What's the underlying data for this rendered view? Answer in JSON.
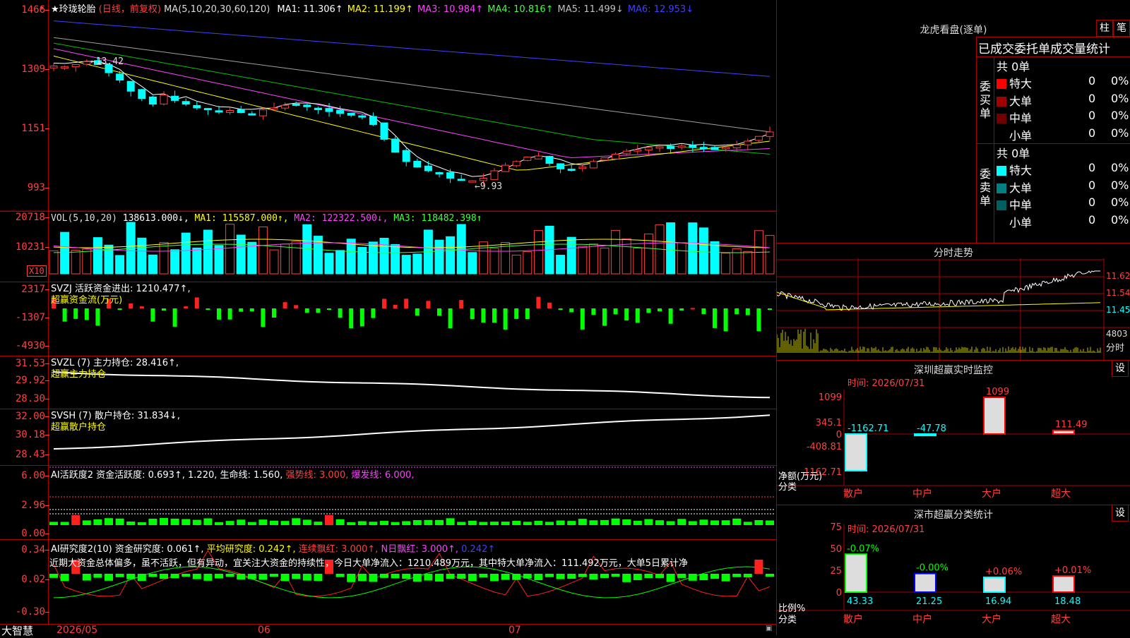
{
  "app": {
    "brand": "大智慧"
  },
  "stock": {
    "name": "★玲珑轮胎",
    "period": "(日线，前复权)",
    "ma_label": "MA(5,10,20,30,60,120)",
    "ma": [
      {
        "k": "MA1:",
        "v": "11.306↑",
        "c": "#ffffff"
      },
      {
        "k": "MA2:",
        "v": "11.199↑",
        "c": "#ffff00"
      },
      {
        "k": "MA3:",
        "v": "10.984↑",
        "c": "#ff40ff"
      },
      {
        "k": "MA4:",
        "v": "10.816↑",
        "c": "#40ff40"
      },
      {
        "k": "MA5:",
        "v": "11.499↓",
        "c": "#c0c0c0"
      },
      {
        "k": "MA6:",
        "v": "12.953↓",
        "c": "#4040ff"
      }
    ],
    "yaxis": [
      "1466",
      "1309",
      "1151",
      "993"
    ],
    "hi_label": "←13.42",
    "lo_label": "←9.93"
  },
  "vol": {
    "label": "VOL(5,10,20)",
    "val": "138613.000↓,",
    "ma1": "MA1: 115587.000↑,",
    "ma2": "MA2: 122322.500↓,",
    "ma3": "MA3: 118482.398↑",
    "yaxis": [
      "20718",
      "10231"
    ],
    "unit": "X10"
  },
  "svzj": {
    "label": "SVZJ  活跃资金进出: 1210.477↑,",
    "sub": "超赢资金流(万元)",
    "yaxis": [
      "2317",
      "-1307",
      "-4930"
    ]
  },
  "svzl": {
    "label": "SVZL (7) 主力持仓: 28.416↑,",
    "sub": "超赢主力持仓",
    "yaxis": [
      "31.53",
      "29.92",
      "28.30"
    ]
  },
  "svsh": {
    "label": "SVSH (7) 散户持仓: 31.834↓,",
    "sub": "超赢散户持仓",
    "yaxis": [
      "32.00",
      "30.18",
      "28.43"
    ]
  },
  "ai1": {
    "label": "AI活跃度2 资金活跃度: 0.693↑, 1.220, 生命线: 1.560,",
    "strong": "强势线: 3.000,",
    "burst": "爆发线: 6.000,",
    "yaxis": [
      "6.00",
      "2.96",
      "0.00"
    ]
  },
  "ai2": {
    "label": "AI研究度2(10) 资金研究度: 0.061↑,",
    "avg": "平均研究度: 0.242↑,",
    "red": "连续飘红: 3.000↑,",
    "nred": "N日飘红: 3.000↑,",
    "last": "0.242↑",
    "comment": "近期大资金总体偏多，虽不活跃，但有异动，宜关注大资金的持续性，今日大单净流入：1210.489万元，其中特大单净流入：111.492万元，大单5日累计净",
    "yaxis": [
      "0.34",
      "0.02",
      "-0.30"
    ]
  },
  "xaxis": [
    "2026/05",
    "06",
    "07"
  ],
  "lhb": {
    "title": "龙虎看盘(逐单)",
    "btn1": "柱",
    "btn2": "笔",
    "heading": "已成交委托单成交量统计",
    "buy_label": "委买单",
    "sell_label": "委卖单",
    "buy_total": "共 0单",
    "sell_total": "共 0单",
    "buy": [
      {
        "n": "特大",
        "c": "#ff0000",
        "v": "0",
        "p": "0%"
      },
      {
        "n": "大单",
        "c": "#a00000",
        "v": "0",
        "p": "0%"
      },
      {
        "n": "中单",
        "c": "#700000",
        "v": "0",
        "p": "0%"
      },
      {
        "n": "小单",
        "c": "#000000",
        "v": "0",
        "p": "0%"
      }
    ],
    "sell": [
      {
        "n": "特大",
        "c": "#00ffff",
        "v": "0",
        "p": "0%"
      },
      {
        "n": "大单",
        "c": "#008080",
        "v": "0",
        "p": "0%"
      },
      {
        "n": "中单",
        "c": "#006060",
        "v": "0",
        "p": "0%"
      },
      {
        "n": "小单",
        "c": "#000000",
        "v": "0",
        "p": "0%"
      }
    ]
  },
  "fenshi": {
    "title": "分时走势",
    "yaxis": [
      "11.62",
      "11.54",
      "11.45"
    ],
    "vol": "4803",
    "vol_label": "分时"
  },
  "monitor": {
    "title": "深圳超赢实时监控",
    "btn": "设",
    "time": "时间: 2026/07/31",
    "yaxis": [
      "1099",
      "345.1",
      "0",
      "-408.81",
      "-1162.71"
    ],
    "net_label": "净额(万元)",
    "cat_label": "分类",
    "bars": [
      {
        "n": "散户",
        "v": -1162.71,
        "t": "-1162.71",
        "c": "#00ffff"
      },
      {
        "n": "中户",
        "v": -47.78,
        "t": "-47.78",
        "c": "#00ffff"
      },
      {
        "n": "大户",
        "v": 1099,
        "t": "1099",
        "c": "#ff0000"
      },
      {
        "n": "超大",
        "v": 111.49,
        "t": "111.49",
        "c": "#ff0000"
      }
    ]
  },
  "stats": {
    "title": "深市超赢分类统计",
    "btn": "设",
    "time": "时间: 2026/07/31",
    "yaxis": [
      "75",
      "50",
      "25",
      "0"
    ],
    "ratio_label": "比例%",
    "cat_label": "分类",
    "bars": [
      {
        "n": "散户",
        "v": 43.33,
        "t": "43.33",
        "d": "-0.07%",
        "c": "#00ff00",
        "dc": "#00ff00"
      },
      {
        "n": "中户",
        "v": 21.25,
        "t": "21.25",
        "d": "-0.00%",
        "c": "#0000ff",
        "dc": "#00ff00"
      },
      {
        "n": "大户",
        "v": 16.94,
        "t": "16.94",
        "d": "+0.06%",
        "c": "#00ffff",
        "dc": "#ff4040"
      },
      {
        "n": "超大",
        "v": 18.48,
        "t": "18.48",
        "d": "+0.01%",
        "c": "#ff0000",
        "dc": "#ff4040"
      }
    ]
  }
}
